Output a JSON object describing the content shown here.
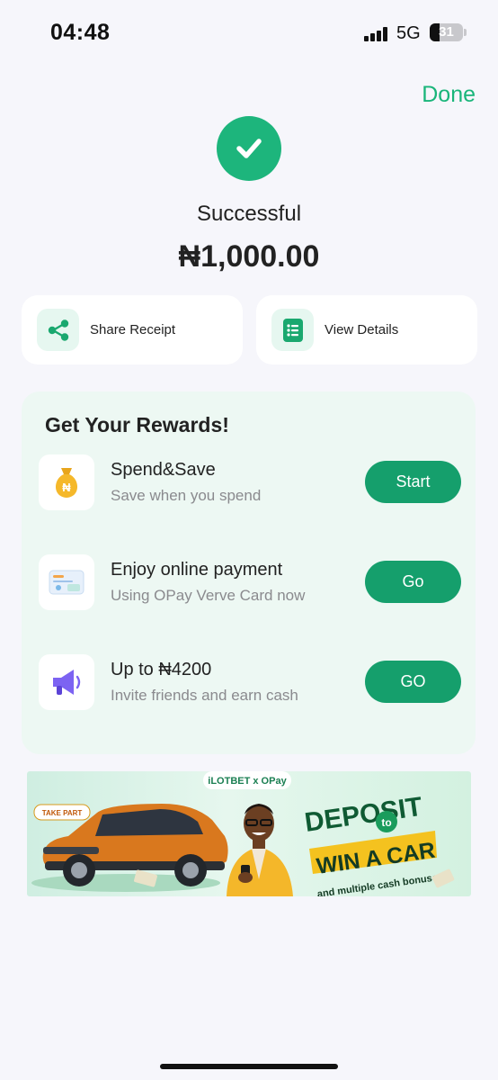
{
  "status_bar": {
    "time": "04:48",
    "network": "5G",
    "battery": "31",
    "battery_level": 0.31
  },
  "header": {
    "done_label": "Done"
  },
  "result": {
    "status": "Successful",
    "amount": "₦1,000.00"
  },
  "actions": [
    {
      "label": "Share Receipt",
      "icon": "share-icon"
    },
    {
      "label": "View Details",
      "icon": "list-icon"
    }
  ],
  "rewards": {
    "title": "Get Your Rewards!",
    "items": [
      {
        "title": "Spend&Save",
        "subtitle": "Save when you spend",
        "button": "Start",
        "icon": "money-bag-icon"
      },
      {
        "title": "Enjoy online payment",
        "subtitle": "Using OPay Verve Card now",
        "button": "Go",
        "icon": "card-icon"
      },
      {
        "title": "Up to ₦4200",
        "subtitle": "Invite friends and earn cash",
        "button": "GO",
        "icon": "megaphone-icon"
      }
    ]
  },
  "banner": {
    "brand": "iLOTBET x OPay",
    "tag": "TAKE PART",
    "headline_1": "DEPOSIT",
    "connector": "to",
    "headline_2": "WIN A CAR",
    "subline": "and multiple cash bonuses"
  },
  "colors": {
    "accent": "#19b57a",
    "button": "#159f6c",
    "rewards_bg": "#edf8f3",
    "page_bg": "#f6f6fb"
  }
}
